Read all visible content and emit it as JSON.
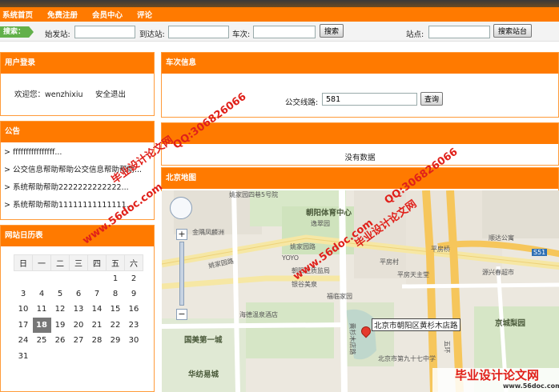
{
  "nav": [
    "系统首页",
    "免费注册",
    "会员中心",
    "评论"
  ],
  "search": {
    "tag": "搜索：",
    "start_label": "始发站:",
    "end_label": "到达站:",
    "train_label": "车次:",
    "search_btn": "搜索",
    "station_label": "站点:",
    "station_btn": "搜索站台"
  },
  "login": {
    "title": "用户登录",
    "welcome": "欢迎您：wenzhixiu",
    "logout": "安全退出"
  },
  "notice": {
    "title": "公告",
    "items": [
      "ffffffffffffffff...",
      "公交信息帮助帮助公交信息帮助帮助...",
      "系统帮助帮助2222222222222...",
      "系统帮助帮助11111111111111..."
    ]
  },
  "calendar": {
    "title": "网站日历表",
    "weekdays": [
      "日",
      "一",
      "二",
      "三",
      "四",
      "五",
      "六"
    ],
    "rows": [
      [
        "",
        "",
        "",
        "",
        "",
        "1",
        "2"
      ],
      [
        "3",
        "4",
        "5",
        "6",
        "7",
        "8",
        "9"
      ],
      [
        "10",
        "11",
        "12",
        "13",
        "14",
        "15",
        "16"
      ],
      [
        "17",
        "18",
        "19",
        "20",
        "21",
        "22",
        "23"
      ],
      [
        "24",
        "25",
        "26",
        "27",
        "28",
        "29",
        "30"
      ],
      [
        "31",
        "",
        "",
        "",
        "",
        "",
        ""
      ]
    ],
    "today": "18"
  },
  "train": {
    "title": "车次信息",
    "route_label": "公交线路:",
    "route_value": "581",
    "query_btn": "查询"
  },
  "nodata": "没有数据",
  "map": {
    "title": "北京地图",
    "popup": "北京市朝阳区黄杉木店路",
    "labels": {
      "l1": "朝阳体育中心",
      "l2": "姚家园路",
      "l3": "逸翠园",
      "l4": "金隅凤麟洲",
      "l5": "姚家园四巷5号院",
      "l6": "朝阳",
      "l7": "平房村",
      "l8": "平房桥",
      "l9": "顺达公寓",
      "l10": "源兴春超市",
      "l11": "平房天主堂",
      "l12": "朝阳区质监局",
      "l13": "银谷美泉",
      "l14": "福临家园",
      "l15": "海德温泉酒店",
      "l16": "国美第一城",
      "l17": "华纺易城",
      "l18": "京城梨园",
      "l19": "北京市第九十七中学",
      "l20": "黄杉木店路",
      "l21": "YOYO",
      "l22": "S51",
      "l23": "姚家园路",
      "l24": "五环",
      "l25": "平房路"
    }
  },
  "watermark": {
    "site": "www.56doc.com",
    "brand": "毕业设计论文网",
    "qq": "QQ:306826066"
  },
  "colors": {
    "orange": "#ff7a00",
    "green": "#62b04a",
    "watermark": "#e0201a"
  }
}
